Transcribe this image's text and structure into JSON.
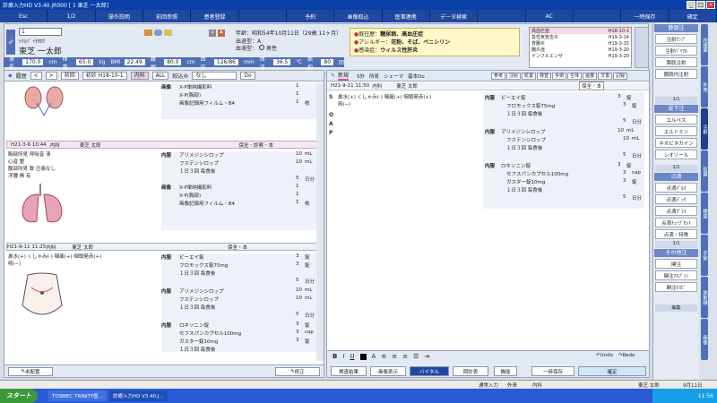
{
  "titlebar": {
    "title": "診療入力HD V3.40.JR000 [    1 東芝  一太郎]"
  },
  "fnbar": [
    "Esc",
    "1/2",
    "操作説明",
    "前回参照",
    "患者登録",
    "",
    "予約",
    "画像取込",
    "医事連携",
    "データ検索",
    "",
    "AC",
    "",
    "一時保存",
    "確定"
  ],
  "patient": {
    "id": "1",
    "kana": "ﾄｳｼﾊﾞ ｲﾁﾀﾛｳ",
    "name": "東芝 一太郎",
    "dob_label": "年齢：",
    "dob": "昭和54年10月11日（29歳 11ヶ月）",
    "kind_label": "出退型：",
    "kind": "A",
    "blood_label": "血液型：",
    "sex": "男性"
  },
  "vitals": [
    {
      "label": "身長",
      "value": "170.0",
      "unit": "cm"
    },
    {
      "label": "体重",
      "value": "65.0",
      "unit": "kg"
    },
    {
      "label": "BMI",
      "value": "22.49"
    },
    {
      "label": "腹囲",
      "value": "80.0",
      "unit": "cm"
    },
    {
      "label": "血圧",
      "value": "126/86",
      "unit": "mm"
    },
    {
      "label": "体温",
      "value": "36.5",
      "unit": "℃"
    },
    {
      "label": "脈拍",
      "value": "80",
      "unit": "回"
    }
  ],
  "alert": [
    {
      "label": "既往歴：",
      "value": "糖尿病、高血圧症"
    },
    {
      "label": "アレルギー：",
      "value": "花粉、そば、ペニシリン"
    },
    {
      "label": "感染症：",
      "value": "ウィルス性肝炎"
    }
  ],
  "diagnosis": [
    {
      "name": "高血圧症",
      "date": "H18-10-1"
    },
    {
      "name": "急性気管支炎",
      "date": "H19-3-14"
    },
    {
      "name": "胃腸炎",
      "date": "H19-3-15"
    },
    {
      "name": "腸炎症",
      "date": "H19-3-20"
    },
    {
      "name": "インフルエンザ",
      "date": "H19-3-20"
    }
  ],
  "left": {
    "header": {
      "history": "履歴",
      "prev": "前回",
      "date_chip": "初診 H18-10-1",
      "tab_rx": "内科",
      "tab_all": "ALL",
      "filter_label": "絞込み",
      "filter_value": "なし",
      "do": "Do"
    },
    "note1": {
      "date": "H21-3-6 10:44",
      "dept": "内科",
      "doctor": "東芝 太郎",
      "tag": "保全・診察・本"
    },
    "note2": {
      "date": "H21-9-11 11:25",
      "dept": "内科",
      "doctor": "東芝 太郎",
      "tag": "保全・本"
    },
    "top_items": [
      {
        "text": "X-P単純撮影料",
        "q": "1"
      },
      {
        "text": "X-P(胸部)",
        "q": "1"
      },
      {
        "text": "画像記録用フィルム・B4",
        "q": "1",
        "u": "枚"
      }
    ],
    "exam1": [
      "胸部所見  呼吸音  清",
      "         心音    整",
      "腹部所見  軟  圧痛なし",
      "浮腫      無  有"
    ],
    "rx1": [
      {
        "text": "アリメジンシロップ",
        "q": "10",
        "u": "mL"
      },
      {
        "text": "フステンシロップ",
        "q": "10",
        "u": "mL"
      },
      {
        "text": "１日３回 毎食後",
        "q": ""
      },
      {
        "text": "",
        "q": "5",
        "u": "日分"
      }
    ],
    "xp2": [
      {
        "text": "X-P単純撮影料",
        "q": "1"
      },
      {
        "text": "X-P(胸部)",
        "q": "1"
      },
      {
        "text": "画像記録用フィルム・B4",
        "q": "1",
        "u": "枚"
      }
    ],
    "exam2": [
      "鼻水(+)  くしゃみ(-)  咽痛(+)  咽頭発赤(+)",
      "咳(−)"
    ],
    "rx2": [
      {
        "text": "ビーエイ錠",
        "q": "3",
        "u": "錠"
      },
      {
        "text": "フロモックス錠75mg",
        "q": "3",
        "u": "錠"
      },
      {
        "text": "１日３回 毎食後",
        "q": ""
      },
      {
        "text": "",
        "q": "5",
        "u": "日分"
      }
    ],
    "rx3": [
      {
        "text": "アリメジンシロップ",
        "q": "10",
        "u": "mL"
      },
      {
        "text": "フステンシロップ",
        "q": "10",
        "u": "mL"
      },
      {
        "text": "１日３回 毎食後",
        "q": ""
      },
      {
        "text": "",
        "q": "5",
        "u": "日分"
      }
    ],
    "rx4": [
      {
        "text": "ロキソニン錠",
        "q": "3",
        "u": "錠"
      },
      {
        "text": "セフスパンカプセル100mg",
        "q": "3",
        "u": "cap"
      },
      {
        "text": "ガスター錠10mg",
        "q": "3",
        "u": "錠"
      },
      {
        "text": "１日３回 毎食後",
        "q": ""
      },
      {
        "text": "",
        "q": "5",
        "u": "日分"
      }
    ],
    "footer": {
      "unfinished": "未配置",
      "edit": "修正"
    }
  },
  "right": {
    "title": "新規",
    "tools": [
      "S外",
      "所見",
      "シェーマ",
      "基本Do"
    ],
    "tabs": [
      "参考",
      "注射",
      "処置",
      "検査",
      "手術",
      "生体",
      "画像",
      "文書",
      "記録"
    ],
    "sub": {
      "date": "H21-9-11 11:50",
      "dept": "内科",
      "doctor": "東芝 太郎",
      "tag": "保全・本"
    },
    "soap": [
      "S",
      "O",
      "A",
      "P"
    ],
    "s_text": "鼻水(+)  くしゃみ(-)  咽痛(+)  咽頭発赤(+)",
    "s_text2": "咳(−)",
    "rx1": [
      {
        "text": "ビーエイ錠",
        "q": "3",
        "u": "錠"
      },
      {
        "text": "フロモックス錠75mg",
        "q": "3",
        "u": "錠"
      },
      {
        "text": "１日３回 毎食後",
        "q": ""
      },
      {
        "text": "",
        "q": "5",
        "u": "日分"
      }
    ],
    "rx2": [
      {
        "text": "アリメジンシロップ",
        "q": "10",
        "u": "mL"
      },
      {
        "text": "フステンシロップ",
        "q": "10",
        "u": "mL"
      },
      {
        "text": "１日３回 毎食後",
        "q": ""
      },
      {
        "text": "",
        "q": "5",
        "u": "日分"
      }
    ],
    "rx3": [
      {
        "text": "ロキソニン錠",
        "q": "3",
        "u": "錠"
      },
      {
        "text": "セフスパンカプセル100mg",
        "q": "3",
        "u": "cap"
      },
      {
        "text": "ガスター錠10mg",
        "q": "3",
        "u": "錠"
      },
      {
        "text": "１日３回 毎食後",
        "q": ""
      },
      {
        "text": "",
        "q": "5",
        "u": "日分"
      }
    ],
    "bottom": [
      "検査結果",
      "画像表示",
      "バイタル",
      "問診表",
      "機能",
      "一時保存",
      "確定"
    ],
    "undo": "Undo",
    "redo": "Redo"
  },
  "sidebar": {
    "sections": [
      {
        "title": "静脈注",
        "page": "1/1",
        "items": [
          "注射ｱﾝﾌﾟ",
          "注射ﾊﾞｲｱﾙ",
          "膀胱注射",
          "膀胱内注射"
        ]
      },
      {
        "title": "皮下注",
        "page": "1/1",
        "items": [
          "エルペス",
          "エルトミン",
          "ネオビタカイン",
          "シオゾール"
        ]
      },
      {
        "title": "点滴",
        "page": "1/1",
        "items": [
          "点滴ﾊﾟﾙｽ",
          "点滴ﾊﾞｯｸ",
          "点滴ｸﾞﾗｽ",
          "点滴ﾁｭｰﾌﾞｾｯﾄ",
          "点滴・特殊"
        ]
      },
      {
        "title": "その他注",
        "page": "1/1",
        "items": [
          "関注",
          "関注ｱﾙﾌﾞﾐﾝ",
          "関注ﾎｽﾋﾟ"
        ]
      }
    ],
    "footer": "編集"
  },
  "vtabs": [
    "内服薬",
    "外用",
    "注射",
    "処置",
    "検査",
    "手術",
    "放射線",
    "画像"
  ],
  "status": {
    "mode": "通常入力",
    "outpatient": "外来",
    "dept": "内科",
    "doctor": "東芝 太郎",
    "date": "9月11日"
  },
  "taskbar": {
    "start": "スタート",
    "tasks": [
      "TOSMEC TRINITY医...",
      "診療入力HD V3.40.J..."
    ],
    "time": "11:56"
  }
}
